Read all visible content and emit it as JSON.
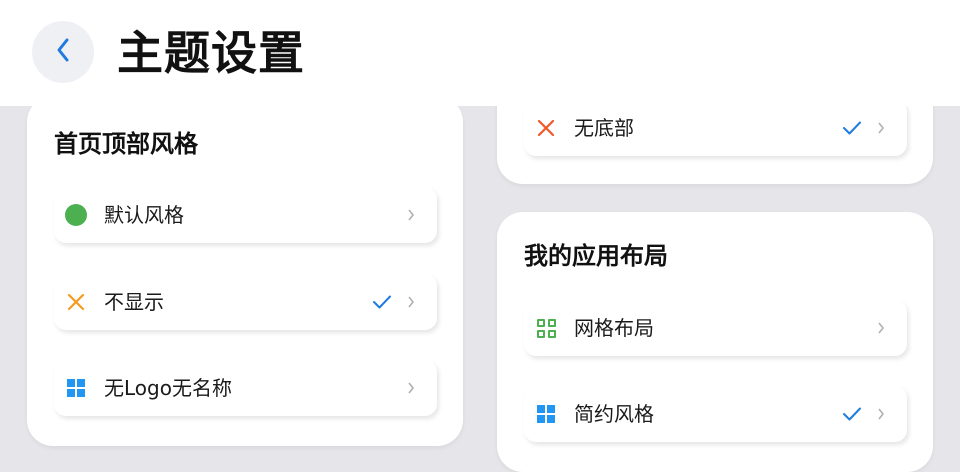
{
  "header": {
    "title": "主题设置"
  },
  "left_card": {
    "title": "首页顶部风格",
    "items": [
      {
        "label": "默认风格",
        "icon": "green-dot-icon",
        "selected": false
      },
      {
        "label": "不显示",
        "icon": "orange-x-icon",
        "selected": true
      },
      {
        "label": "无Logo无名称",
        "icon": "blue-windows-icon",
        "selected": false
      }
    ]
  },
  "right_top_card": {
    "items": [
      {
        "label": "无底部",
        "icon": "red-x-icon",
        "selected": true
      }
    ]
  },
  "right_card": {
    "title": "我的应用布局",
    "items": [
      {
        "label": "网格布局",
        "icon": "green-grid-icon",
        "selected": false
      },
      {
        "label": "简约风格",
        "icon": "blue-windows-icon",
        "selected": true
      }
    ]
  },
  "colors": {
    "accent_blue": "#1e7be0",
    "green": "#4caf50",
    "orange": "#f59a23",
    "red": "#f0592a",
    "background": "#e6e6ea"
  }
}
